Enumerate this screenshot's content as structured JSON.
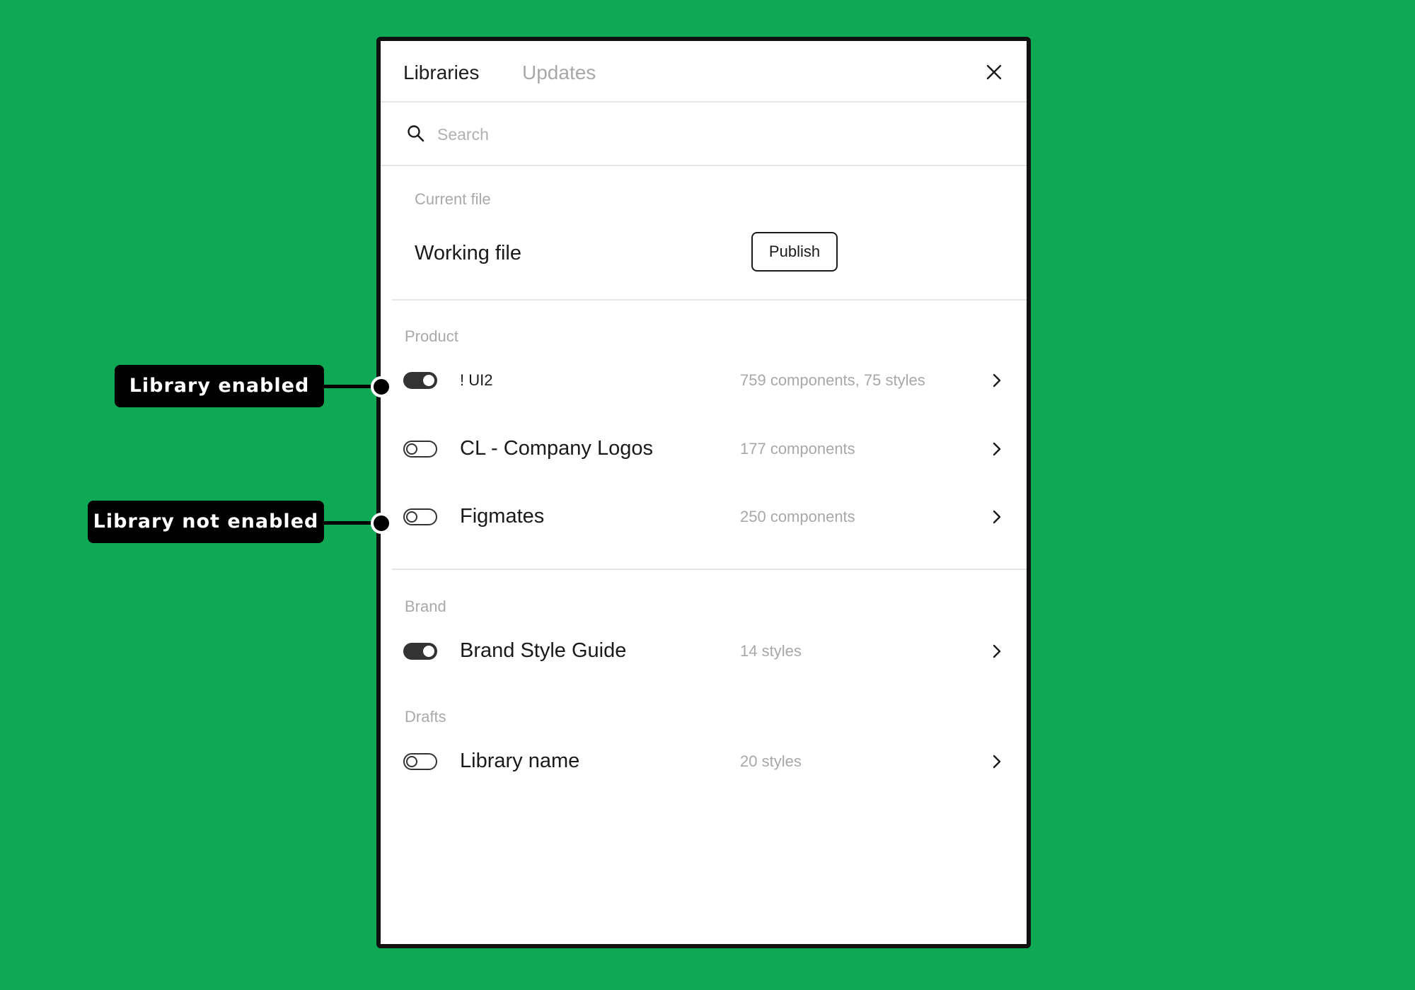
{
  "colors": {
    "background": "#0fa855",
    "dialog_border": "#111111",
    "muted_text": "#a8a8a8",
    "primary_text": "#1a1a1a",
    "toggle": "#333333"
  },
  "header": {
    "tabs": [
      {
        "label": "Libraries",
        "active": true
      },
      {
        "label": "Updates",
        "active": false
      }
    ],
    "close_icon": "close-icon"
  },
  "search": {
    "icon": "search-icon",
    "placeholder": "Search",
    "value": ""
  },
  "current_file": {
    "section_label": "Current file",
    "file_name": "Working file",
    "publish_label": "Publish"
  },
  "sections": [
    {
      "label": "Product",
      "libraries": [
        {
          "name": "! UI2",
          "meta": "759 components, 75 styles",
          "enabled": true
        },
        {
          "name": "CL - Company Logos",
          "meta": "177 components",
          "enabled": false
        },
        {
          "name": "Figmates",
          "meta": "250 components",
          "enabled": false
        }
      ]
    },
    {
      "label": "Brand",
      "libraries": [
        {
          "name": "Brand Style Guide",
          "meta": "14 styles",
          "enabled": true
        }
      ]
    },
    {
      "label": "Drafts",
      "libraries": [
        {
          "name": "Library name",
          "meta": "20 styles",
          "enabled": false
        }
      ]
    }
  ],
  "annotations": {
    "enabled_label": "Library enabled",
    "not_enabled_label": "Library not enabled"
  }
}
